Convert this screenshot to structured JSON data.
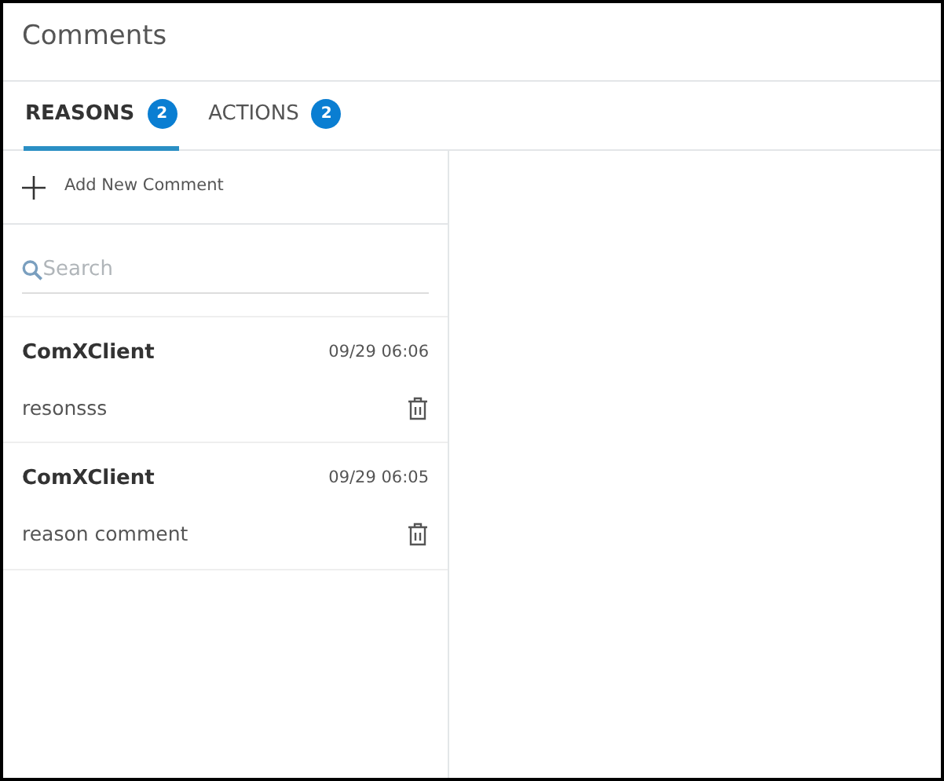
{
  "window": {
    "title": "Comments"
  },
  "tabs": [
    {
      "label": "REASONS",
      "count": "2",
      "selected": true
    },
    {
      "label": "ACTIONS",
      "count": "2",
      "selected": false
    }
  ],
  "add_button": {
    "label": "Add New Comment"
  },
  "search": {
    "placeholder": "Search"
  },
  "comments": [
    {
      "author": "ComXClient",
      "time": "09/29 06:06",
      "text": "resonsss"
    },
    {
      "author": "ComXClient",
      "time": "09/29 06:05",
      "text": "reason comment"
    }
  ]
}
